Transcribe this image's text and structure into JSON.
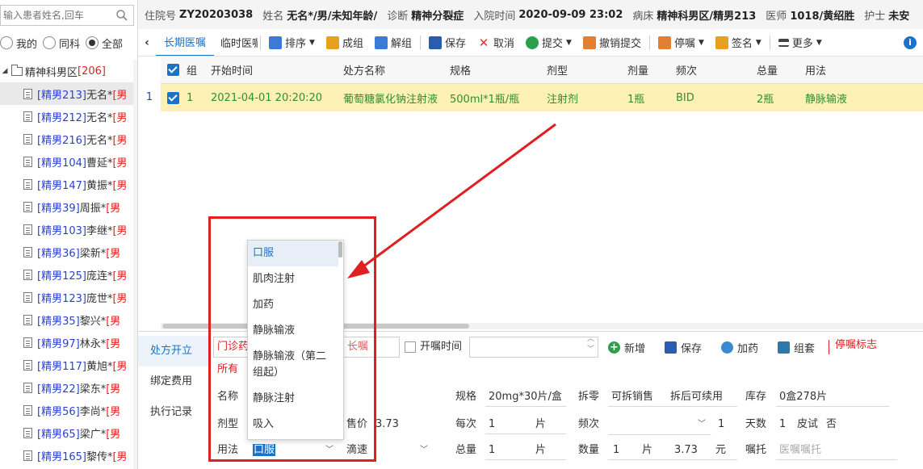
{
  "sidebar": {
    "search_placeholder": "输入患者姓名,回车",
    "scope": [
      {
        "label": "我的",
        "selected": false
      },
      {
        "label": "同科",
        "selected": false
      },
      {
        "label": "全部",
        "selected": true
      }
    ],
    "ward": {
      "name": "精神科男区",
      "count": "[206]"
    },
    "patients": [
      {
        "bed": "[精男213]",
        "name": "无名*",
        "sex": "[男",
        "selected": true
      },
      {
        "bed": "[精男212]",
        "name": "无名*",
        "sex": "[男",
        "selected": false
      },
      {
        "bed": "[精男216]",
        "name": "无名*",
        "sex": "[男",
        "selected": false
      },
      {
        "bed": "[精男104]",
        "name": "曹延*",
        "sex": "[男",
        "selected": false
      },
      {
        "bed": "[精男147]",
        "name": "黄振*",
        "sex": "[男",
        "selected": false
      },
      {
        "bed": "[精男39]",
        "name": "周振*",
        "sex": "[男",
        "selected": false
      },
      {
        "bed": "[精男103]",
        "name": "李继*",
        "sex": "[男",
        "selected": false
      },
      {
        "bed": "[精男36]",
        "name": "梁新*",
        "sex": "[男",
        "selected": false
      },
      {
        "bed": "[精男125]",
        "name": "庞连*",
        "sex": "[男",
        "selected": false
      },
      {
        "bed": "[精男123]",
        "name": "庞世*",
        "sex": "[男",
        "selected": false
      },
      {
        "bed": "[精男35]",
        "name": "黎兴*",
        "sex": "[男",
        "selected": false
      },
      {
        "bed": "[精男97]",
        "name": "林永*",
        "sex": "[男",
        "selected": false
      },
      {
        "bed": "[精男117]",
        "name": "黄旭*",
        "sex": "[男",
        "selected": false
      },
      {
        "bed": "[精男22]",
        "name": "梁东*",
        "sex": "[男",
        "selected": false
      },
      {
        "bed": "[精男56]",
        "name": "李尚*",
        "sex": "[男",
        "selected": false
      },
      {
        "bed": "[精男65]",
        "name": "梁广*",
        "sex": "[男",
        "selected": false
      },
      {
        "bed": "[精男165]",
        "name": "黎传*",
        "sex": "[男",
        "selected": false
      }
    ]
  },
  "infobar": [
    {
      "label": "住院号",
      "value": "ZY20203038"
    },
    {
      "label": "姓名",
      "value": "无名*/男/未知年龄/"
    },
    {
      "label": "诊断",
      "value": "精神分裂症"
    },
    {
      "label": "入院时间",
      "value": "2020-09-09 23:02"
    },
    {
      "label": "病床",
      "value": "精神科男区/精男213"
    },
    {
      "label": "医师",
      "value": "1018/黄绍胜"
    },
    {
      "label": "护士",
      "value": "未安"
    }
  ],
  "toolbar": {
    "back": "‹",
    "tabs": [
      {
        "label": "长期医嘱",
        "active": true
      },
      {
        "label": "临时医嘱",
        "active": false
      }
    ],
    "buttons": [
      {
        "id": "sort",
        "label": "排序",
        "icon": "sort-icon",
        "dropdown": true,
        "color": "#3a7bd5"
      },
      {
        "id": "group",
        "label": "成组",
        "icon": "group-icon",
        "dropdown": false,
        "color": "#e8a020"
      },
      {
        "id": "ungroup",
        "label": "解组",
        "icon": "ungroup-icon",
        "dropdown": false,
        "color": "#3a7bd5"
      },
      {
        "id": "save",
        "label": "保存",
        "icon": "save-icon",
        "dropdown": false,
        "color": "#2a5db0"
      },
      {
        "id": "cancel",
        "label": "取消",
        "icon": "cancel-icon",
        "dropdown": false,
        "color": "#e03030"
      },
      {
        "id": "submit",
        "label": "提交",
        "icon": "submit-icon",
        "dropdown": true,
        "color": "#2aa04a"
      },
      {
        "id": "revoke",
        "label": "撤销提交",
        "icon": "revoke-icon",
        "dropdown": false,
        "color": "#e08030"
      },
      {
        "id": "stop",
        "label": "停嘱",
        "icon": "stop-icon",
        "dropdown": true,
        "color": "#e08030"
      },
      {
        "id": "sign",
        "label": "签名",
        "icon": "sign-icon",
        "dropdown": true,
        "color": "#e8a020"
      },
      {
        "id": "more",
        "label": "更多",
        "icon": "menu-icon",
        "dropdown": true,
        "color": "#444444"
      }
    ]
  },
  "grid": {
    "columns": [
      "组",
      "开始时间",
      "处方名称",
      "规格",
      "剂型",
      "剂量",
      "频次",
      "总量",
      "用法"
    ],
    "rows": [
      {
        "num": "1",
        "group": "1",
        "start": "2021-04-01 20:20:20",
        "name": "葡萄糖氯化钠注射液",
        "spec": "500ml*1瓶/瓶",
        "form": "注射剂",
        "dose": "1瓶",
        "freq": "BID",
        "total": "2瓶",
        "usage": "静脉输液"
      }
    ]
  },
  "editor": {
    "side_tabs": [
      {
        "label": "处方开立",
        "active": true
      },
      {
        "label": "绑定费用",
        "active": false
      },
      {
        "label": "执行记录",
        "active": false
      }
    ],
    "type_select": "门诊药",
    "type_filter": "所有",
    "order_kind": "长嘱",
    "open_time_label": "开嘱时间",
    "buttons": [
      {
        "id": "new",
        "label": "新增",
        "icon": "add-icon"
      },
      {
        "id": "save2",
        "label": "保存",
        "icon": "save-icon"
      },
      {
        "id": "add-drug",
        "label": "加药",
        "icon": "add-drug-icon"
      },
      {
        "id": "kit",
        "label": "组套",
        "icon": "kit-icon"
      }
    ],
    "stop_flag": "停嘱标志",
    "labels": {
      "name": "名称",
      "form": "剂型",
      "usage": "用法",
      "spec": "规格",
      "split": "拆零",
      "stock": "库存",
      "price": "售价",
      "each": "每次",
      "freq": "频次",
      "days": "天数",
      "skin": "皮试",
      "drip": "滴速",
      "total": "总量",
      "qty": "数量",
      "note": "嘱托"
    },
    "values": {
      "spec": "20mg*30片/盒",
      "split_sale": "可拆销售",
      "split_reuse": "拆后可续用",
      "stock": "0盒278片",
      "price": "3.73",
      "each": "1",
      "each_unit": "片",
      "freq_count": "1",
      "days": "1",
      "skin": "否",
      "usage": "口服",
      "total": "1",
      "total_unit": "片",
      "qty": "1",
      "qty_unit": "片",
      "amount": "3.73",
      "amount_unit": "元",
      "note_placeholder": "医嘱嘱托"
    }
  },
  "usage_dropdown": {
    "options": [
      "口服",
      "肌肉注射",
      "加药",
      "静脉输液",
      "静脉输液（第二组起）",
      "静脉注射",
      "吸入"
    ],
    "highlighted": 0
  },
  "annotation_color": "#e02020"
}
